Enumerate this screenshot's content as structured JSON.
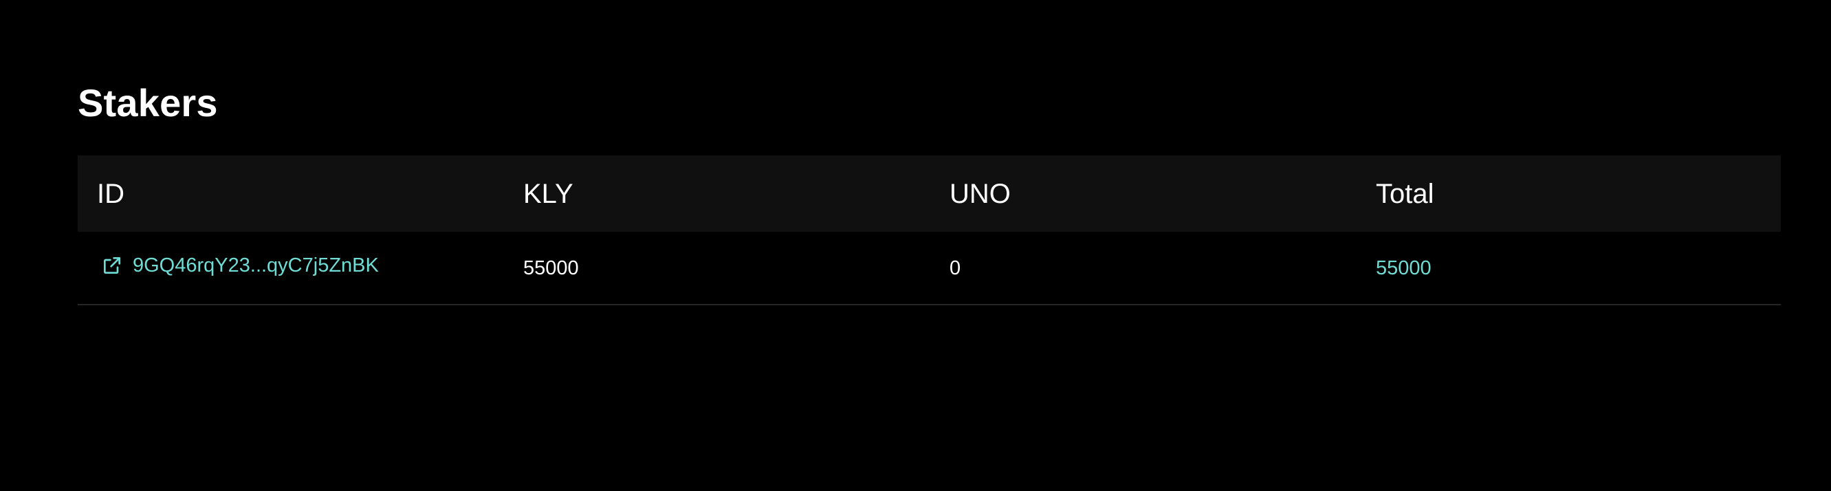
{
  "page": {
    "title": "Stakers"
  },
  "colors": {
    "background": "#000000",
    "header_bg": "#101010",
    "accent": "#6fdcd6",
    "text": "#ffffff",
    "divider": "#262626"
  },
  "table": {
    "columns": [
      "ID",
      "KLY",
      "UNO",
      "Total"
    ],
    "rows": [
      {
        "id": "9GQ46rqY23...qyC7j5ZnBK",
        "id_icon": "external-link-icon",
        "kly": "55000",
        "uno": "0",
        "total": "55000"
      }
    ]
  }
}
